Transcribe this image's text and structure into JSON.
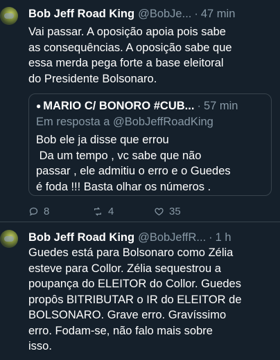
{
  "tweets": [
    {
      "author_name": "Bob Jeff Road King",
      "handle": "@BobJe...",
      "separator": "·",
      "time": "47 min",
      "text": "Vai passar. A oposição apoia pois sabe\nas consequências. A oposição sabe que\nessa merda pega forte a base eleitoral\ndo Presidente Bolsonaro.",
      "quote": {
        "bullet": "●",
        "author_name": "MARIO C/ BONORO #CUB...",
        "separator": "·",
        "time": "57 min",
        "reply_to": "Em resposta a @BobJeffRoadKing",
        "text": "Bob ele ja disse que errou\n Da um tempo , vc sabe que não\npassar , ele admitiu o erro e o Guedes\né foda !!! Basta olhar os números ."
      },
      "actions": {
        "replies": "8",
        "retweets": "4",
        "likes": "35"
      }
    },
    {
      "author_name": "Bob Jeff Road King",
      "handle": "@BobJeffR...",
      "separator": "·",
      "time": "1 h",
      "text": "Guedes está para Bolsonaro como Zélia\nesteve para Collor. Zélia sequestrou a\npoupança do ELEITOR do Collor. Guedes\npropôs BITRIBUTAR o IR do ELEITOR de\nBOLSONARO. Grave erro. Gravíssimo\nerro. Fodam-se, não falo mais sobre\nisso."
    }
  ],
  "icons": {
    "reply": "speech-bubble-icon",
    "retweet": "retweet-icon",
    "like": "heart-icon"
  },
  "colors": {
    "background": "#15202b",
    "text": "#ffffff",
    "secondary": "#8899a6",
    "border": "#38444d"
  }
}
